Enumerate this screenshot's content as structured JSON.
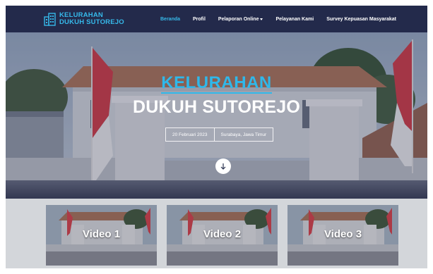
{
  "brand": {
    "line1": "KELURAHAN",
    "line2": "DUKUH SUTOREJO",
    "icon": "building-icon",
    "color": "#36b9ea"
  },
  "nav": {
    "items": [
      {
        "label": "Beranda",
        "active": true
      },
      {
        "label": "Profil",
        "active": false
      },
      {
        "label": "Pelaporan Online",
        "active": false,
        "dropdown": true
      },
      {
        "label": "Pelayanan Kami",
        "active": false
      },
      {
        "label": "Survey Kepuasan Masyarakat",
        "active": false
      }
    ],
    "background": "#232a4b",
    "active_color": "#36b9ea"
  },
  "hero": {
    "title_line1": "KELURAHAN",
    "title_line2": "DUKUH SUTOREJO",
    "date": "20 Februari 2023",
    "location": "Surabaya, Jawa Timur",
    "scroll_icon": "arrow-down-icon"
  },
  "videos": [
    {
      "label": "Video 1"
    },
    {
      "label": "Video 2"
    },
    {
      "label": "Video 3"
    }
  ]
}
